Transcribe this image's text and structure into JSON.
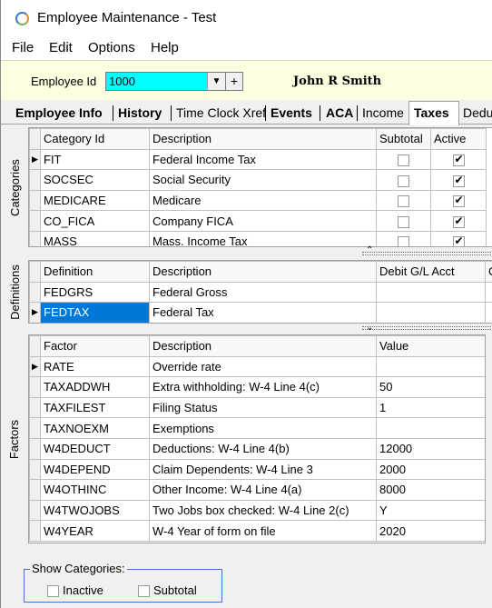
{
  "window": {
    "title": "Employee Maintenance - Test"
  },
  "menu": [
    "File",
    "Edit",
    "Options",
    "Help"
  ],
  "employee": {
    "label": "Employee Id",
    "id_value": "1000",
    "add_symbol": "+",
    "name": "John R Smith"
  },
  "tabs": [
    {
      "label": "Employee Info",
      "bold": true
    },
    {
      "label": "History",
      "bold": true
    },
    {
      "label": "Time Clock Xref",
      "bold": false
    },
    {
      "label": "Events",
      "bold": true
    },
    {
      "label": "ACA",
      "bold": true
    },
    {
      "label": "Income",
      "bold": false
    },
    {
      "label": "Taxes",
      "bold": true,
      "active": true
    },
    {
      "label": "Deduc",
      "bold": false
    }
  ],
  "categories": {
    "side_label": "Categories",
    "headers": [
      "Category Id",
      "Description",
      "Subtotal",
      "Active"
    ],
    "rows": [
      {
        "id": "FIT",
        "description": "Federal Income Tax",
        "subtotal": false,
        "active": true,
        "current": true
      },
      {
        "id": "SOCSEC",
        "description": "Social Security",
        "subtotal": false,
        "active": true
      },
      {
        "id": "MEDICARE",
        "description": "Medicare",
        "subtotal": false,
        "active": true
      },
      {
        "id": "CO_FICA",
        "description": "Company FICA",
        "subtotal": false,
        "active": true
      },
      {
        "id": "MASS",
        "description": "Mass. Income Tax",
        "subtotal": false,
        "active": true
      }
    ]
  },
  "definitions": {
    "side_label": "Definitions",
    "headers": [
      "Definition",
      "Description",
      "Debit G/L Acct",
      "C"
    ],
    "rows": [
      {
        "id": "FEDGRS",
        "description": "Federal Gross"
      },
      {
        "id": "FEDTAX",
        "description": "Federal Tax",
        "current": true,
        "selected": true
      }
    ]
  },
  "factors": {
    "side_label": "Factors",
    "headers": [
      "Factor",
      "Description",
      "Value"
    ],
    "rows": [
      {
        "id": "RATE",
        "description": "Override rate",
        "value": "",
        "current": true
      },
      {
        "id": "TAXADDWH",
        "description": "Extra withholding: W-4 Line 4(c)",
        "value": "50"
      },
      {
        "id": "TAXFILEST",
        "description": "Filing Status",
        "value": "1"
      },
      {
        "id": "TAXNOEXM",
        "description": "Exemptions",
        "value": ""
      },
      {
        "id": "W4DEDUCT",
        "description": "Deductions: W-4 Line 4(b)",
        "value": "12000"
      },
      {
        "id": "W4DEPEND",
        "description": "Claim Dependents: W-4 Line 3",
        "value": "2000"
      },
      {
        "id": "W4OTHINC",
        "description": "Other Income: W-4 Line 4(a)",
        "value": "8000"
      },
      {
        "id": "W4TWOJOBS",
        "description": "Two Jobs box checked: W-4 Line 2(c)",
        "value": "Y"
      },
      {
        "id": "W4YEAR",
        "description": "W-4 Year of form on file",
        "value": "2020"
      }
    ]
  },
  "show_categories": {
    "legend": "Show Categories:",
    "inactive_label": "Inactive",
    "subtotal_label": "Subtotal",
    "inactive_checked": false,
    "subtotal_checked": false
  },
  "icons": {
    "app": "app-logo-icon",
    "dropdown": "chevron-down-icon",
    "row_indicator": "row-pointer-icon"
  }
}
